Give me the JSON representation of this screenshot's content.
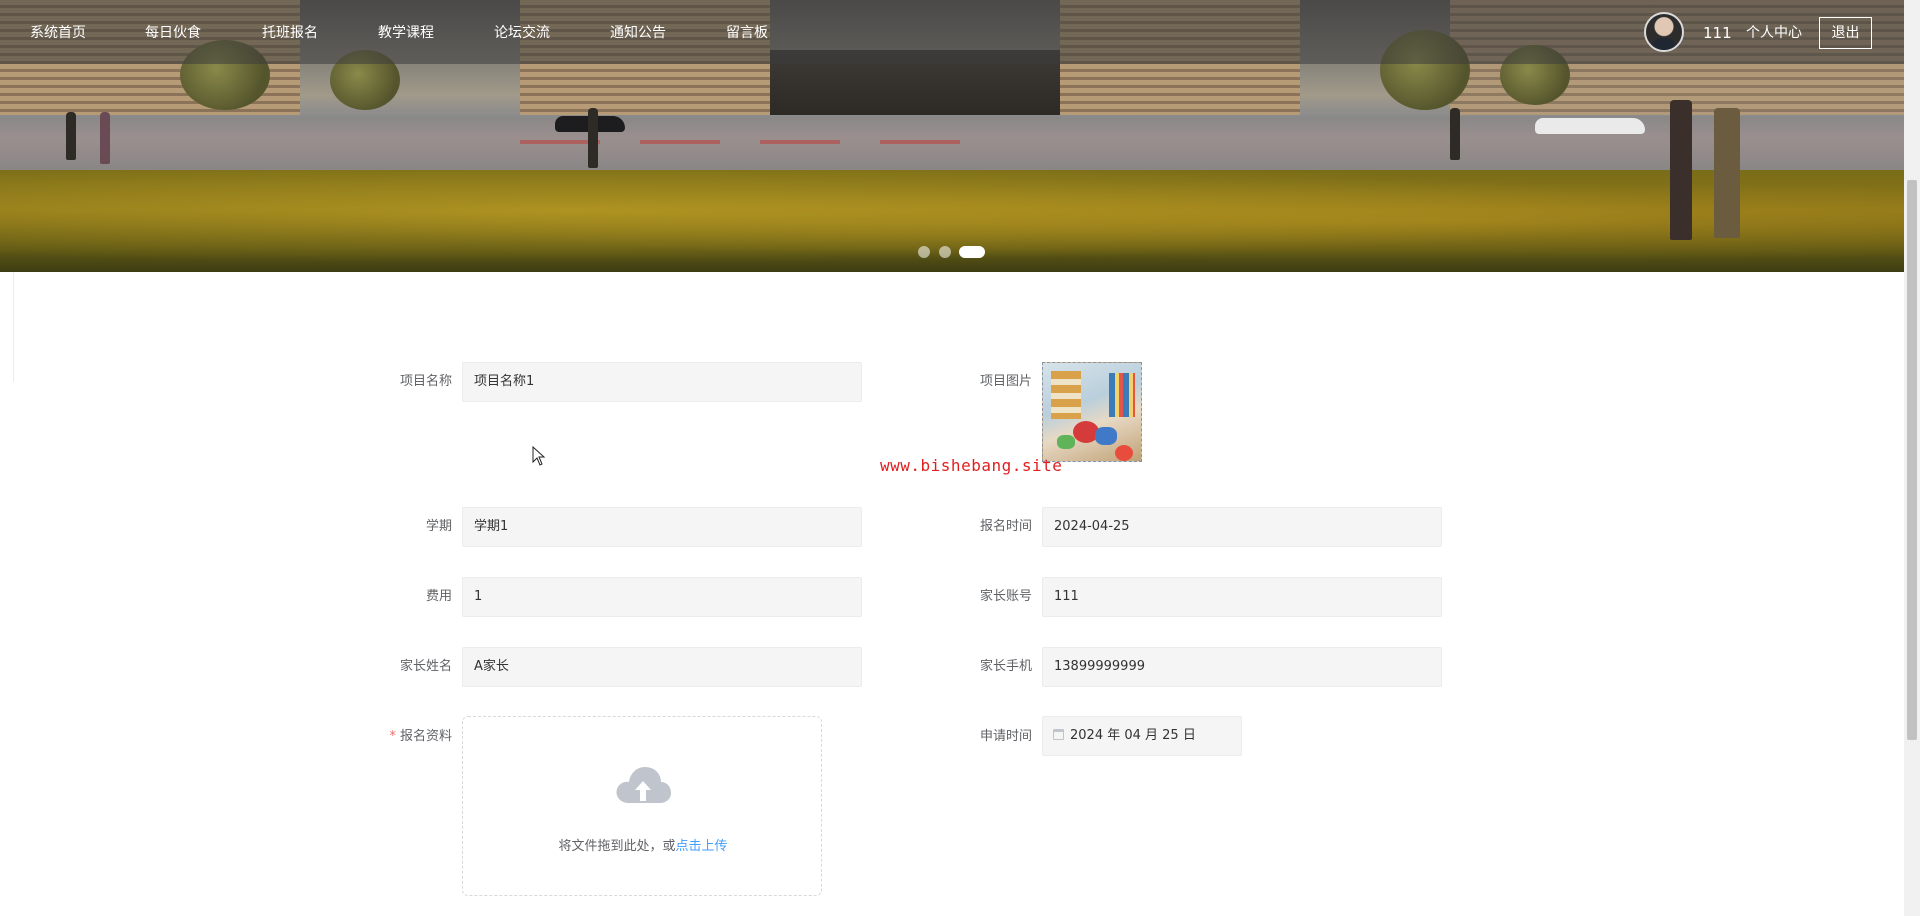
{
  "nav": {
    "items": [
      {
        "label": "系统首页"
      },
      {
        "label": "每日伙食"
      },
      {
        "label": "托班报名"
      },
      {
        "label": "教学课程"
      },
      {
        "label": "论坛交流"
      },
      {
        "label": "通知公告"
      },
      {
        "label": "留言板"
      }
    ],
    "user_name": "111",
    "profile_label": "个人中心",
    "logout_label": "退出"
  },
  "carousel": {
    "slide_count": 3,
    "active_index": 2
  },
  "form": {
    "project_name": {
      "label": "项目名称",
      "value": "项目名称1"
    },
    "project_image": {
      "label": "项目图片"
    },
    "semester": {
      "label": "学期",
      "value": "学期1"
    },
    "register_time": {
      "label": "报名时间",
      "value": "2024-04-25"
    },
    "fee": {
      "label": "费用",
      "value": "1"
    },
    "parent_account": {
      "label": "家长账号",
      "value": "111"
    },
    "parent_name": {
      "label": "家长姓名",
      "value": "A家长"
    },
    "parent_phone": {
      "label": "家长手机",
      "value": "13899999999"
    },
    "materials": {
      "label": "报名资料",
      "required_mark": "*",
      "drop_text": "将文件拖到此处，或",
      "click_text": "点击上传"
    },
    "apply_time": {
      "label": "申请时间",
      "value": "2024 年 04 月 25 日"
    }
  },
  "watermark": "www.bishebang.site",
  "colors": {
    "nav_bg": "#3c3c3c",
    "field_bg": "#f5f5f5",
    "link": "#409eff",
    "required": "#f56c6c",
    "watermark": "#e02020"
  }
}
